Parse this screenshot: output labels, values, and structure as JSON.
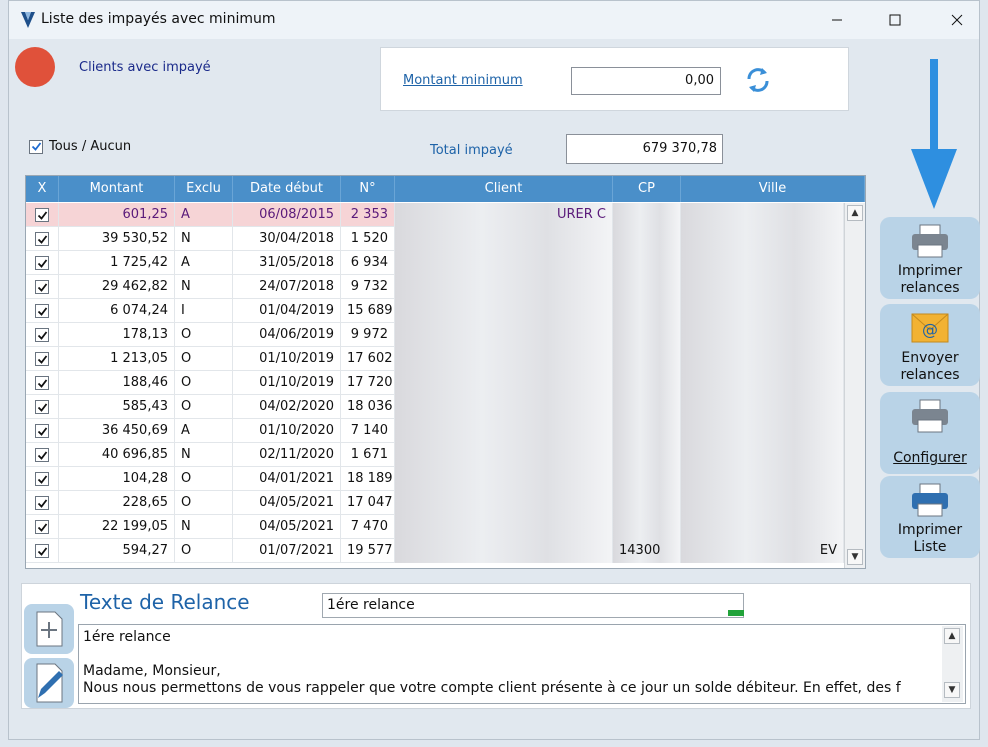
{
  "window": {
    "title": "Liste des impayés avec minimum"
  },
  "header": {
    "clients_label": "Clients avec  impayé",
    "montant_minimum_label": "Montant minimum",
    "montant_minimum_value": "0,00",
    "tous_aucun_label": "Tous / Aucun",
    "total_label": "Total  impayé",
    "total_value": "679 370,78"
  },
  "table": {
    "columns": [
      "X",
      "Montant",
      "Exclu",
      "Date début",
      "N°",
      "Client",
      "CP",
      "Ville"
    ],
    "rows": [
      {
        "montant": "601,25",
        "exclu": "A",
        "date": "06/08/2015",
        "num": "2 353",
        "client": "URER C",
        "cp": "",
        "ville": ""
      },
      {
        "montant": "39 530,52",
        "exclu": "N",
        "date": "30/04/2018",
        "num": "1 520",
        "client": "",
        "cp": "",
        "ville": ""
      },
      {
        "montant": "1 725,42",
        "exclu": "A",
        "date": "31/05/2018",
        "num": "6 934",
        "client": "",
        "cp": "",
        "ville": ""
      },
      {
        "montant": "29 462,82",
        "exclu": "N",
        "date": "24/07/2018",
        "num": "9 732",
        "client": "",
        "cp": "",
        "ville": ""
      },
      {
        "montant": "6 074,24",
        "exclu": "I",
        "date": "01/04/2019",
        "num": "15 689",
        "client": "",
        "cp": "",
        "ville": ""
      },
      {
        "montant": "178,13",
        "exclu": "O",
        "date": "04/06/2019",
        "num": "9 972",
        "client": "",
        "cp": "",
        "ville": ""
      },
      {
        "montant": "1 213,05",
        "exclu": "O",
        "date": "01/10/2019",
        "num": "17 602",
        "client": "",
        "cp": "",
        "ville": ""
      },
      {
        "montant": "188,46",
        "exclu": "O",
        "date": "01/10/2019",
        "num": "17 720",
        "client": "",
        "cp": "",
        "ville": ""
      },
      {
        "montant": "585,43",
        "exclu": "O",
        "date": "04/02/2020",
        "num": "18 036",
        "client": "",
        "cp": "",
        "ville": ""
      },
      {
        "montant": "36 450,69",
        "exclu": "A",
        "date": "01/10/2020",
        "num": "7 140",
        "client": "",
        "cp": "",
        "ville": ""
      },
      {
        "montant": "40 696,85",
        "exclu": "N",
        "date": "02/11/2020",
        "num": "1 671",
        "client": "",
        "cp": "",
        "ville": ""
      },
      {
        "montant": "104,28",
        "exclu": "O",
        "date": "04/01/2021",
        "num": "18 189",
        "client": "",
        "cp": "",
        "ville": ""
      },
      {
        "montant": "228,65",
        "exclu": "O",
        "date": "04/05/2021",
        "num": "17 047",
        "client": "",
        "cp": "",
        "ville": ""
      },
      {
        "montant": "22 199,05",
        "exclu": "N",
        "date": "04/05/2021",
        "num": "7 470",
        "client": "",
        "cp": "",
        "ville": ""
      },
      {
        "montant": "594,27",
        "exclu": "O",
        "date": "01/07/2021",
        "num": "19 577",
        "client": "",
        "cp": "14300",
        "ville": "EV"
      }
    ]
  },
  "actions": {
    "imprimer_relances": [
      "Imprimer",
      "relances"
    ],
    "envoyer_relances": [
      "Envoyer",
      "relances"
    ],
    "configurer": "Configurer",
    "imprimer_liste": [
      "Imprimer",
      "Liste"
    ]
  },
  "relance": {
    "title": "Texte de Relance",
    "selected": "1ére relance",
    "lines": [
      "1ére relance",
      "",
      "Madame, Monsieur,",
      "Nous nous permettons de vous rappeler que votre compte client présente à ce jour un solde débiteur. En effet, des f"
    ]
  },
  "colors": {
    "accent": "#4a8fc9",
    "selected_row": "#f6d4d6",
    "status_dot": "#e0513a",
    "label_blue": "#1e63a8"
  }
}
